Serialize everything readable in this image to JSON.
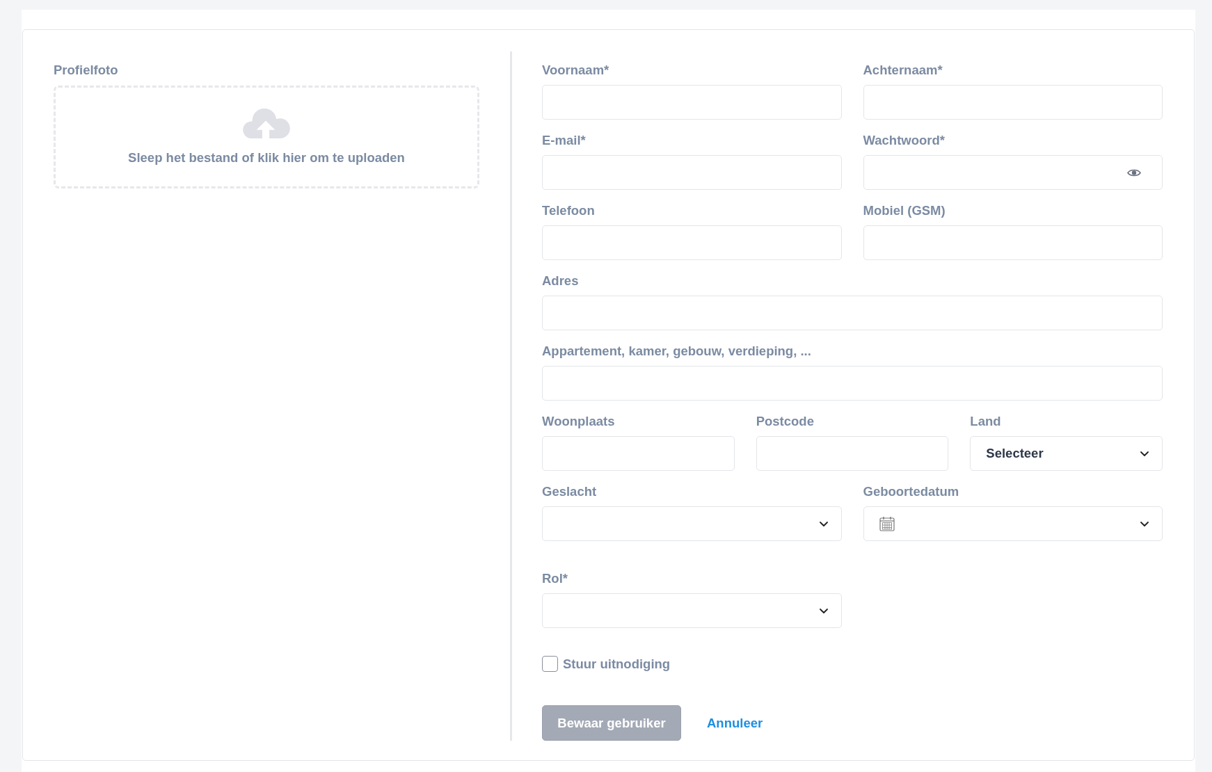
{
  "photo": {
    "label": "Profielfoto",
    "hint": "Sleep het bestand of klik hier om te uploaden"
  },
  "form": {
    "rows": [
      {
        "fields": [
          {
            "label": "Voornaam*",
            "kind": "text"
          },
          {
            "label": "Achternaam*",
            "kind": "text"
          }
        ]
      },
      {
        "fields": [
          {
            "label": "E-mail*",
            "kind": "text"
          },
          {
            "label": "Wachtwoord*",
            "kind": "password"
          }
        ]
      },
      {
        "fields": [
          {
            "label": "Telefoon",
            "kind": "text"
          },
          {
            "label": "Mobiel (GSM)",
            "kind": "text"
          }
        ]
      },
      {
        "fields": [
          {
            "label": "Adres",
            "kind": "text"
          }
        ]
      },
      {
        "fields": [
          {
            "label": "Appartement, kamer, gebouw, verdieping, ...",
            "kind": "text"
          }
        ]
      },
      {
        "fields": [
          {
            "label": "Woonplaats",
            "kind": "text"
          },
          {
            "label": "Postcode",
            "kind": "text"
          },
          {
            "label": "Land",
            "kind": "select",
            "value": "Selecteer"
          }
        ]
      },
      {
        "fields": [
          {
            "label": "Geslacht",
            "kind": "select"
          },
          {
            "label": "Geboortedatum",
            "kind": "date"
          }
        ]
      },
      {
        "fields": [
          {
            "label": "Rol*",
            "kind": "select"
          }
        ]
      }
    ]
  },
  "invite": {
    "label": "Stuur uitnodiging",
    "checked": false
  },
  "actions": [
    {
      "label": "Bewaar gebruiker",
      "kind": "button",
      "disabled": true
    },
    {
      "label": "Annuleer",
      "kind": "link"
    }
  ]
}
